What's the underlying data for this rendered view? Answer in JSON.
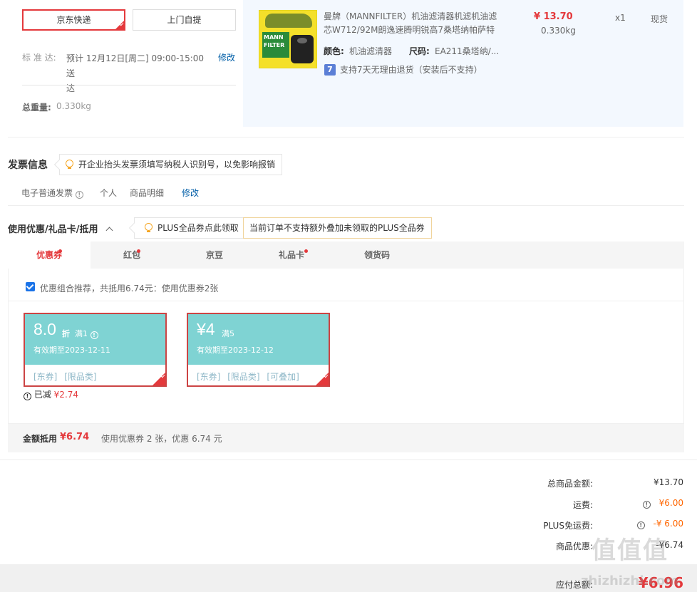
{
  "shipping": {
    "jd_express": "京东快递",
    "pickup": "上门自提",
    "standard_label": "标 准 达:",
    "standard_value_l1": "预计 12月12日[周二] 09:00-15:00 送",
    "standard_value_l2": "达",
    "modify": "修改",
    "weight_label": "总重量:",
    "weight_value": "0.330kg"
  },
  "product": {
    "title_l1": "曼牌（MANNFILTER）机油滤清器机滤机油滤",
    "title_l2": "芯W712/92M朗逸速腾明锐高7桑塔纳帕萨特",
    "price": "¥ 13.70",
    "weight": "0.330kg",
    "qty": "x1",
    "stock": "现货",
    "color_label": "颜色:",
    "color_value": "机油滤清器",
    "size_label": "尺码:",
    "size_value": "EA211桑塔纳/...",
    "return_badge": "7",
    "return_text": "支持7天无理由退货（安装后不支持）",
    "image_text": "MANN FILTER"
  },
  "invoice": {
    "title": "发票信息",
    "tip": "开企业抬头发票须填写纳税人识别号，以免影响报销",
    "type": "电子普通发票",
    "person": "个人",
    "detail": "商品明细",
    "modify": "修改"
  },
  "discount": {
    "title": "使用优惠/礼品卡/抵用",
    "plus_tip": "PLUS全品券点此领取",
    "plus_note": "当前订单不支持额外叠加未领取的PLUS全品券",
    "tabs": [
      "优惠券",
      "红包",
      "京豆",
      "礼品卡",
      "领货码"
    ],
    "combo_text": "优惠组合推荐，共抵用6.74元：使用优惠券2张",
    "coupon1": {
      "value": "8.0",
      "unit": "折",
      "cond": "满1",
      "expiry": "有效期至2023-12-11",
      "tags": [
        "[东券]",
        "[限品类]"
      ],
      "saved_label": "已减",
      "saved_value": "¥2.74"
    },
    "coupon2": {
      "value": "¥4",
      "cond": "满5",
      "expiry": "有效期至2023-12-12",
      "tags": [
        "[东券]",
        "[限品类]",
        "[可叠加]"
      ]
    },
    "summary_label": "金额抵用",
    "summary_value": "¥6.74",
    "summary_text": "使用优惠券 2 张，优惠 6.74 元"
  },
  "totals": {
    "goods_label": "总商品金额:",
    "goods_value": "¥13.70",
    "freight_label": "运费:",
    "freight_value": "¥6.00",
    "plus_free_label": "PLUS免运费:",
    "plus_free_value": "-¥ 6.00",
    "promo_label": "商品优惠:",
    "promo_value": "-¥6.74",
    "payable_label": "应付总额:",
    "payable_value": "¥6.96"
  },
  "watermark": {
    "logo": "值值值",
    "site": "zhizhizhi.com"
  },
  "colors": {
    "accent": "#e4393c",
    "teal": "#7fd3d3",
    "orange": "#ff6600",
    "link": "#005ea7"
  }
}
